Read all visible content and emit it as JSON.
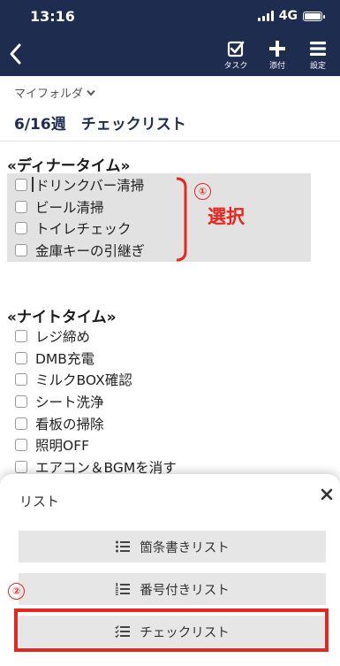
{
  "status_bar": {
    "time": "13:16",
    "network": "4G"
  },
  "nav": {
    "task_label": "タスク",
    "attach_label": "添付",
    "settings_label": "設定"
  },
  "folder": {
    "label": "マイフォルダ"
  },
  "page_title": "6/16週　チェックリスト",
  "sections": [
    {
      "title": "«ディナータイム»",
      "items": [
        "ドリンクバー清掃",
        "ビール清掃",
        "トイレチェック",
        "金庫キーの引継ぎ"
      ]
    },
    {
      "title": "«ナイトタイム»",
      "items": [
        "レジ締め",
        "DMB充電",
        "ミルクBOX確認",
        "シート洗浄",
        "看板の掃除",
        "照明OFF",
        "エアコン＆BGMを消す"
      ]
    }
  ],
  "annotations": {
    "step1_number": "①",
    "step1_text": "選択",
    "step2_number": "②",
    "accent_color": "#e8251e"
  },
  "sheet": {
    "title": "リスト",
    "options": [
      "箇条書きリスト",
      "番号付きリスト",
      "チェックリスト"
    ]
  },
  "colors": {
    "header_bg": "#1d2c4f",
    "selection_bg": "#e2e2e2",
    "option_bg": "#e6e6e6"
  }
}
